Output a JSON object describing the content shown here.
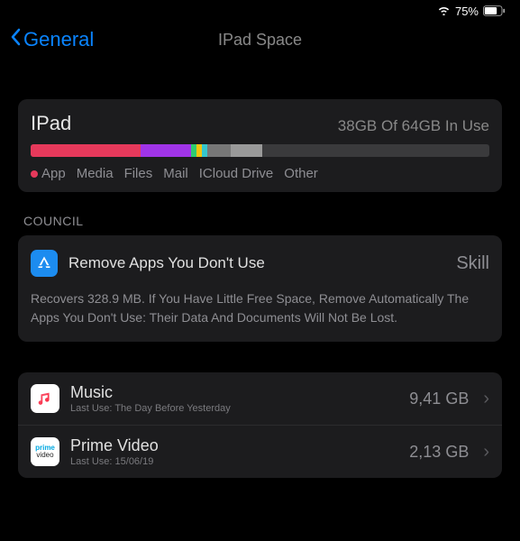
{
  "status": {
    "battery_pct": "75%",
    "wifi": true
  },
  "nav": {
    "back_label": "General",
    "title": "IPad Space"
  },
  "storage": {
    "device": "IPad",
    "usage_text": "38GB Of 64GB In Use",
    "segments": [
      {
        "label": "App",
        "color": "#e6395b",
        "width": 24
      },
      {
        "label": "Media",
        "color": "#a034e8",
        "width": 11
      },
      {
        "label": "Files",
        "color": "#2ecc71",
        "width": 1.2
      },
      {
        "label": "Mail",
        "color": "#f1c40f",
        "width": 1.2
      },
      {
        "label": "ICloud Drive",
        "color": "#34c6cd",
        "width": 1.2
      },
      {
        "label": "",
        "color": "#777",
        "width": 5
      },
      {
        "label": "Other",
        "color": "#999",
        "width": 7
      }
    ]
  },
  "council": {
    "header": "COUNCIL",
    "title": "Remove Apps You Don't Use",
    "action": "Skill",
    "description": "Recovers 328.9 MB. If You Have Little Free Space, Remove Automatically The Apps You Don't Use: Their Data And Documents Will Not Be Lost."
  },
  "apps": [
    {
      "name": "Music",
      "sub": "Last Use: The Day Before Yesterday",
      "size": "9,41 GB",
      "icon": "music"
    },
    {
      "name": "Prime Video",
      "sub": "Last Use: 15/06/19",
      "size": "2,13 GB",
      "icon": "prime"
    }
  ]
}
